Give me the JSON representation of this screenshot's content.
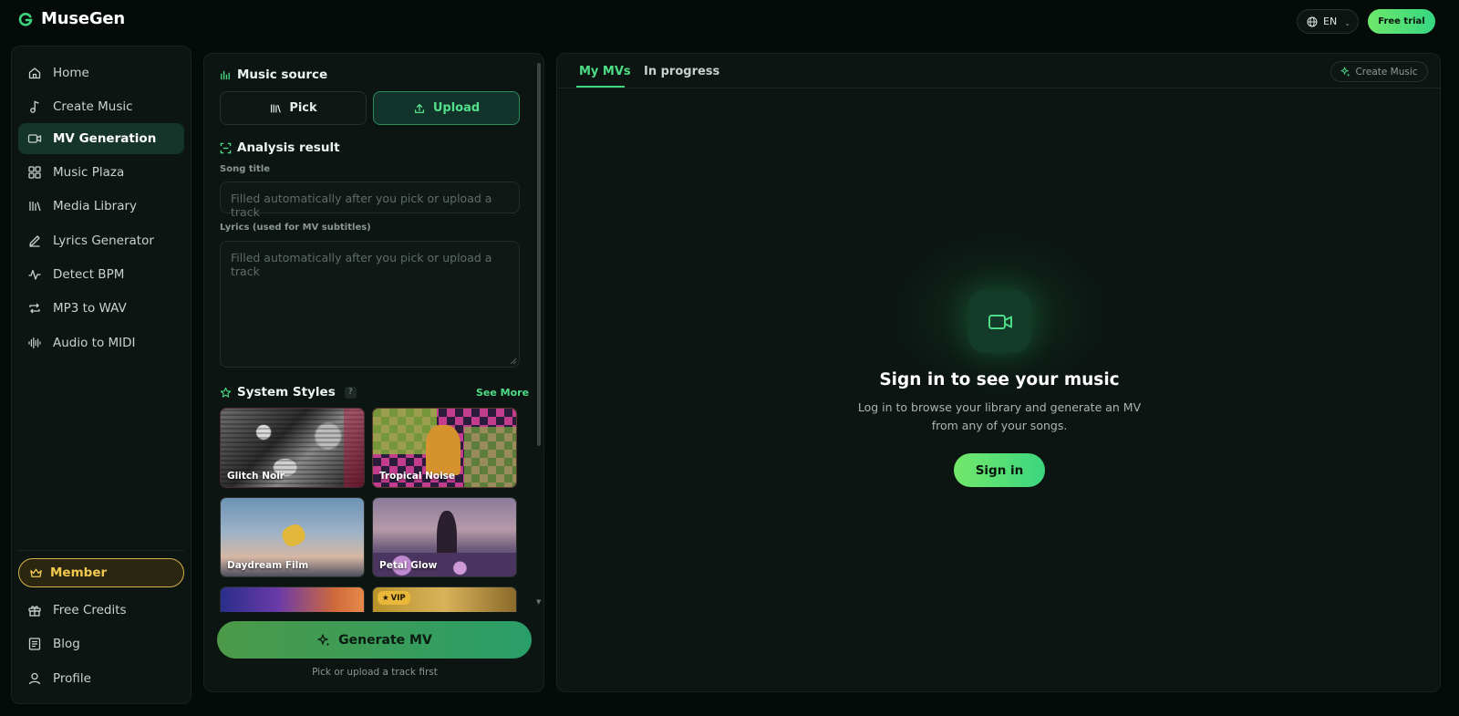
{
  "header": {
    "app_name": "MuseGen",
    "language": "EN",
    "free_trial_label": "Free trial"
  },
  "sidebar": {
    "items": [
      {
        "label": "Home",
        "icon": "home-icon"
      },
      {
        "label": "Create Music",
        "icon": "music-note-icon"
      },
      {
        "label": "MV Generation",
        "icon": "video-camera-icon",
        "active": true
      },
      {
        "label": "Music Plaza",
        "icon": "grid-icon"
      },
      {
        "label": "Media Library",
        "icon": "library-icon"
      },
      {
        "label": "Lyrics Generator",
        "icon": "pen-icon"
      },
      {
        "label": "Detect BPM",
        "icon": "pulse-icon"
      },
      {
        "label": "MP3 to WAV",
        "icon": "convert-icon"
      },
      {
        "label": "Audio to MIDI",
        "icon": "waveform-icon"
      }
    ],
    "member_label": "Member",
    "bottom_items": [
      {
        "label": "Free Credits",
        "icon": "gift-icon"
      },
      {
        "label": "Blog",
        "icon": "blog-icon"
      },
      {
        "label": "Profile",
        "icon": "user-icon"
      }
    ]
  },
  "mv_panel": {
    "music_source_title": "Music source",
    "pick_label": "Pick",
    "upload_label": "Upload",
    "analysis_title": "Analysis result",
    "song_title_label": "Song title",
    "song_title_placeholder": "Filled automatically after you pick or upload a track",
    "lyrics_label": "Lyrics (used for MV subtitles)",
    "lyrics_placeholder": "Filled automatically after you pick or upload a track",
    "styles_title": "System Styles",
    "help_mark": "?",
    "see_more_label": "See More",
    "styles": [
      {
        "name": "Glitch Noir"
      },
      {
        "name": "Tropical Noise"
      },
      {
        "name": "Daydream Film"
      },
      {
        "name": "Petal Glow"
      },
      {
        "name": ""
      },
      {
        "name": "",
        "badge": "VIP"
      }
    ],
    "generate_label": "Generate MV",
    "generate_hint": "Pick or upload a track first"
  },
  "right_panel": {
    "tabs": [
      {
        "label": "My MVs",
        "active": true
      },
      {
        "label": "In progress"
      }
    ],
    "create_music_label": "Create Music",
    "empty_title": "Sign in to see your music",
    "empty_desc": "Log in to browse your library and generate an MV from any of your songs.",
    "sign_in_label": "Sign in"
  },
  "colors": {
    "background": "#050b09",
    "panel": "#0c1512",
    "accent_green": "#4fdc86",
    "member_gold": "#f2c84f"
  }
}
